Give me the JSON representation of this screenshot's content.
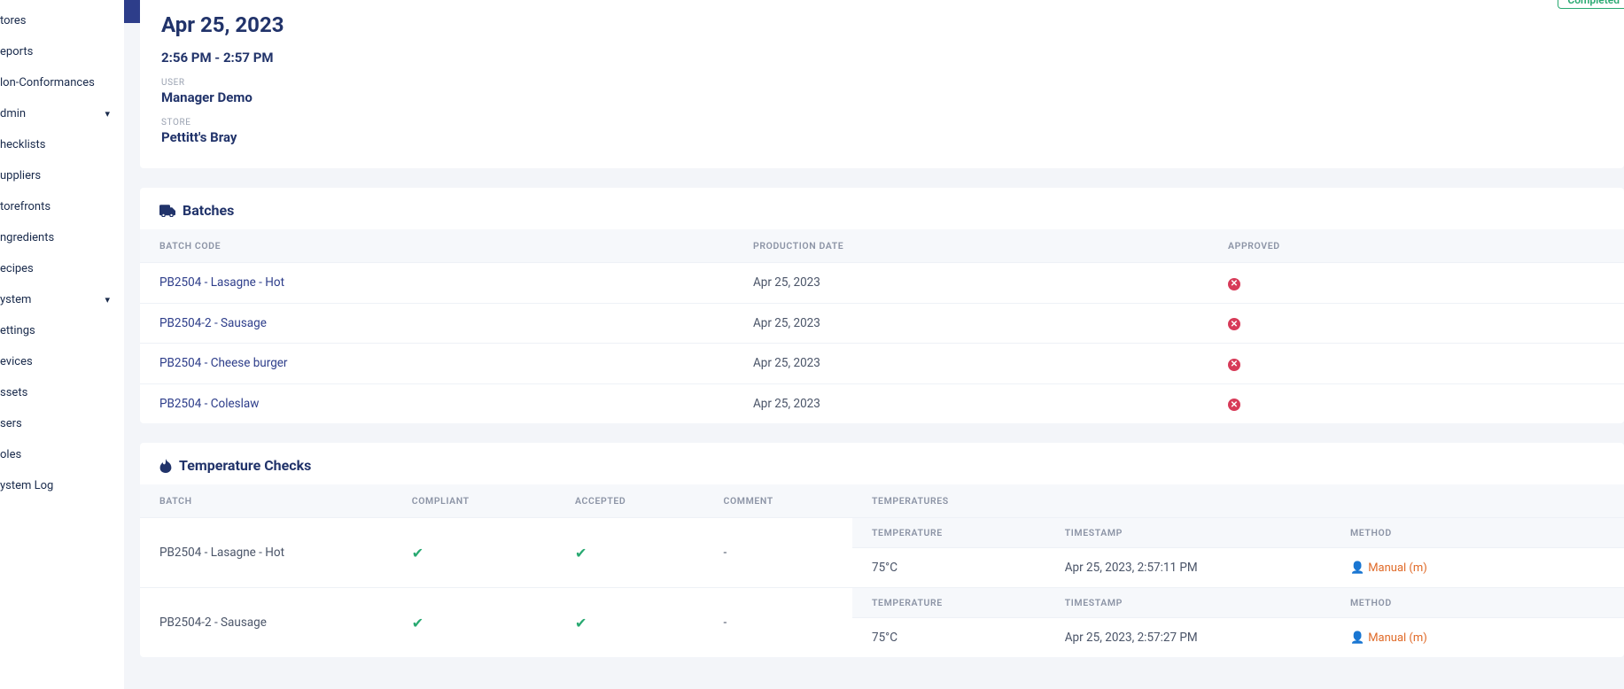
{
  "sidebar": {
    "items": [
      {
        "label": "tores",
        "expandable": false
      },
      {
        "label": "eports",
        "expandable": false
      },
      {
        "label": "lon-Conformances",
        "expandable": false
      },
      {
        "label": "dmin",
        "expandable": true
      },
      {
        "label": "hecklists",
        "expandable": false
      },
      {
        "label": "uppliers",
        "expandable": false
      },
      {
        "label": "torefronts",
        "expandable": false
      },
      {
        "label": "ngredients",
        "expandable": false
      },
      {
        "label": "ecipes",
        "expandable": false
      },
      {
        "label": "ystem",
        "expandable": true
      },
      {
        "label": "ettings",
        "expandable": false
      },
      {
        "label": "evices",
        "expandable": false
      },
      {
        "label": "ssets",
        "expandable": false
      },
      {
        "label": "sers",
        "expandable": false
      },
      {
        "label": "oles",
        "expandable": false
      },
      {
        "label": "ystem Log",
        "expandable": false
      }
    ]
  },
  "header": {
    "status": "Completed",
    "date": "Apr 25, 2023",
    "time_range": "2:56 PM - 2:57 PM",
    "user_label": "USER",
    "user_value": "Manager Demo",
    "store_label": "STORE",
    "store_value": "Pettitt's Bray"
  },
  "batches": {
    "title": "Batches",
    "columns": {
      "c1": "BATCH CODE",
      "c2": "PRODUCTION DATE",
      "c3": "APPROVED"
    },
    "rows": [
      {
        "code": "PB2504 - Lasagne - Hot",
        "date": "Apr 25, 2023",
        "approved": false
      },
      {
        "code": "PB2504-2 - Sausage",
        "date": "Apr 25, 2023",
        "approved": false
      },
      {
        "code": "PB2504 - Cheese burger",
        "date": "Apr 25, 2023",
        "approved": false
      },
      {
        "code": "PB2504 - Coleslaw",
        "date": "Apr 25, 2023",
        "approved": false
      }
    ]
  },
  "temps": {
    "title": "Temperature Checks",
    "columns": {
      "c1": "BATCH",
      "c2": "COMPLIANT",
      "c3": "ACCEPTED",
      "c4": "COMMENT",
      "c5": "TEMPERATURES"
    },
    "sub_columns": {
      "s1": "TEMPERATURE",
      "s2": "TIMESTAMP",
      "s3": "METHOD"
    },
    "rows": [
      {
        "batch": "PB2504 - Lasagne - Hot",
        "compliant": true,
        "accepted": true,
        "comment": "-",
        "temp": "75°C",
        "timestamp": "Apr 25, 2023, 2:57:11 PM",
        "method": "Manual (m)"
      },
      {
        "batch": "PB2504-2 - Sausage",
        "compliant": true,
        "accepted": true,
        "comment": "-",
        "temp": "75°C",
        "timestamp": "Apr 25, 2023, 2:57:27 PM",
        "method": "Manual (m)"
      }
    ]
  }
}
